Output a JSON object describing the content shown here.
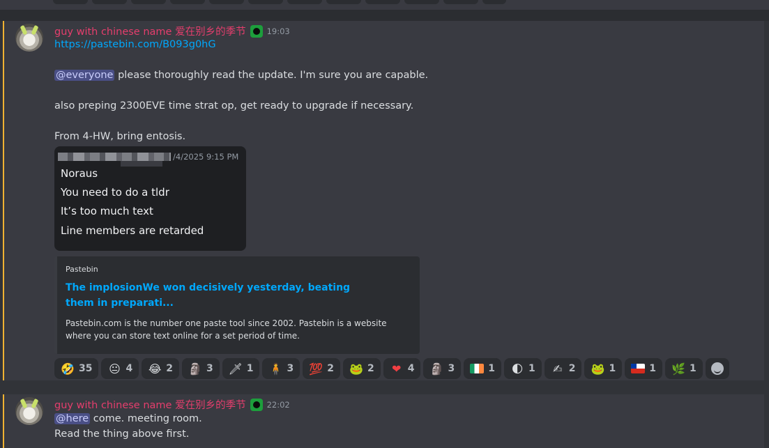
{
  "colors": {
    "accent_username": "#e53e6d",
    "link": "#00a8fc",
    "highlight_bar": "#f0b232",
    "mention_bg": "#4a4f86"
  },
  "messages": [
    {
      "username": "guy with chinese name 爱在别乡的季节",
      "role_icon": "alien-badge-icon",
      "time": "19:03",
      "link": "https://pastebin.com/B093g0hG",
      "mention": "@everyone",
      "line1_rest": "please thoroughly read the update. I'm sure you are capable.",
      "line2": "also preping 2300EVE time strat op, get ready to upgrade if necessary.",
      "line3": "From 4-HW, bring entosis.",
      "quote": {
        "date": "/4/2025 9:15 PM",
        "lines": [
          "Noraus",
          "You need to do a tldr",
          "It’s too much text",
          "Line members are retarded"
        ]
      },
      "embed": {
        "provider": "Pastebin",
        "title": "The implosionWe won decisively yesterday, beating them in preparati...",
        "description": "Pastebin.com is the number one paste tool since 2002. Pastebin is a website where you can store text online for a set period of time."
      },
      "reactions": [
        {
          "icon": "rofl-emoji-icon",
          "glyph": "🤣",
          "count": "35"
        },
        {
          "icon": "custom-meme-emoji-icon",
          "glyph": "😐",
          "count": "4"
        },
        {
          "icon": "laughing-emoji-icon",
          "glyph": "😂",
          "count": "2"
        },
        {
          "icon": "custom-face-emoji-icon",
          "glyph": "🗿",
          "count": "3"
        },
        {
          "icon": "custom-sword-emoji-icon",
          "glyph": "🗡",
          "count": "1"
        },
        {
          "icon": "custom-person-emoji-icon",
          "glyph": "🧍",
          "count": "3"
        },
        {
          "icon": "hundred-emoji-icon",
          "glyph": "💯",
          "count": "2"
        },
        {
          "icon": "custom-pepe-emoji-icon",
          "glyph": "🐸",
          "count": "2"
        },
        {
          "icon": "red-heart-emoji-icon",
          "glyph": "❤",
          "count": "4"
        },
        {
          "icon": "custom-face2-emoji-icon",
          "glyph": "🗿",
          "count": "3"
        },
        {
          "icon": "ireland-flag-emoji-icon",
          "glyph": "",
          "count": "1"
        },
        {
          "icon": "custom-black-yellow-emoji-icon",
          "glyph": "🌓",
          "count": "1"
        },
        {
          "icon": "custom-sketch-emoji-icon",
          "glyph": "✍",
          "count": "2"
        },
        {
          "icon": "pepe-emoji-icon",
          "glyph": "🐸",
          "count": "1"
        },
        {
          "icon": "chile-flag-emoji-icon",
          "glyph": "",
          "count": "1"
        },
        {
          "icon": "custom-plant-emoji-icon",
          "glyph": "🌿",
          "count": "1"
        }
      ],
      "add_reaction_icon": "add-reaction-icon"
    },
    {
      "username": "guy with chinese name 爱在别乡的季节",
      "role_icon": "alien-badge-icon",
      "time": "22:02",
      "mention": "@here",
      "line1_rest": "come. meeting room.",
      "line2": "Read the thing above first."
    }
  ]
}
